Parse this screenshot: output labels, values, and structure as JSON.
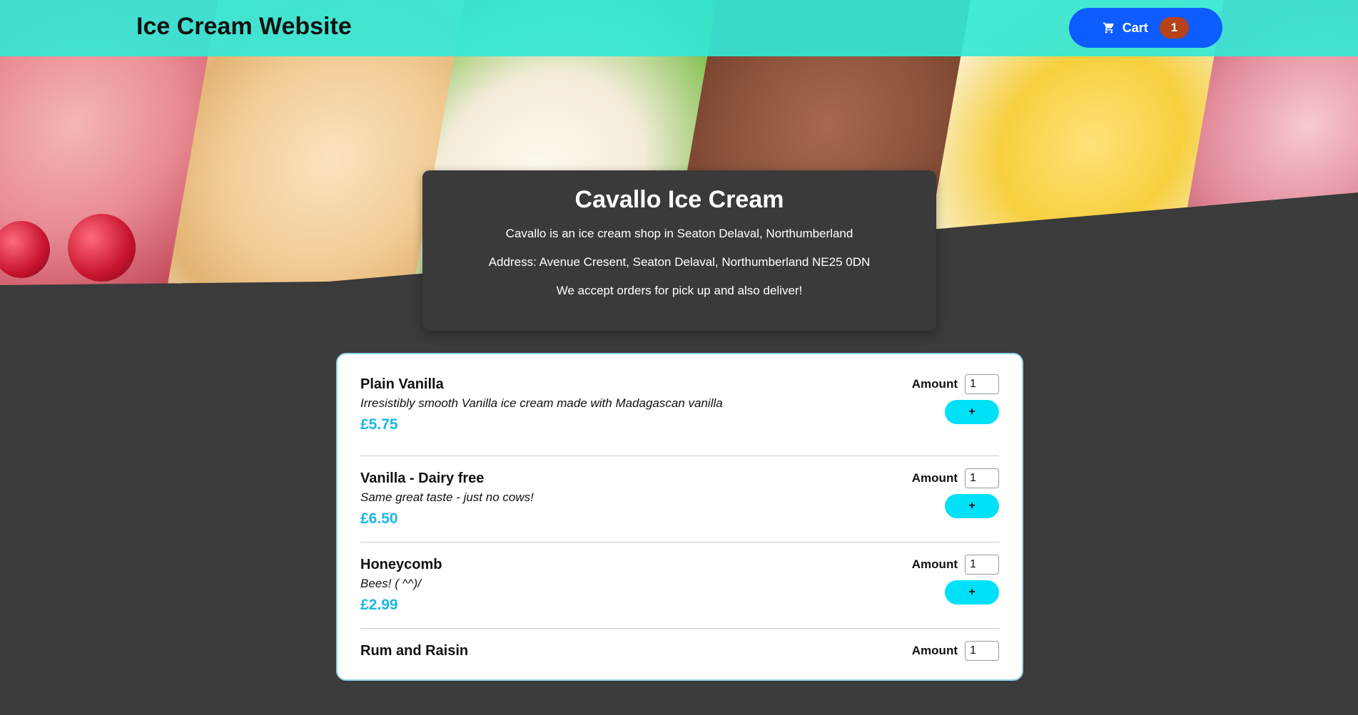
{
  "navbar": {
    "brand": "Ice Cream Website",
    "cart_label": "Cart",
    "cart_count": "1",
    "cart_icon": "shopping-cart-icon"
  },
  "hero": {
    "image": "ice-cream-collage"
  },
  "info": {
    "title": "Cavallo Ice Cream",
    "lines": [
      "Cavallo is an ice cream shop in Seaton Delaval, Northumberland",
      "Address: Avenue Cresent, Seaton Delaval, Northumberland NE25 0DN",
      "We accept orders for pick up and also deliver!"
    ]
  },
  "menu": {
    "amount_label": "Amount",
    "add_label": "+",
    "items": [
      {
        "name": "Plain Vanilla",
        "description": "Irresistibly smooth Vanilla ice cream made with Madagascan vanilla",
        "price": "£5.75",
        "amount": "1"
      },
      {
        "name": "Vanilla - Dairy free",
        "description": "Same great taste - just no cows!",
        "price": "£6.50",
        "amount": "1"
      },
      {
        "name": "Honeycomb",
        "description": "Bees! ( ^^)/",
        "price": "£2.99",
        "amount": "1"
      },
      {
        "name": "Rum and Raisin",
        "description": "",
        "price": "",
        "amount": "1"
      }
    ]
  },
  "colors": {
    "navbar": "#34e7d6",
    "cart_button": "#0d5cff",
    "cart_badge": "#b8421a",
    "page_background": "#3b3b3b",
    "price": "#1ab8e6",
    "add_button": "#00e0f7"
  }
}
